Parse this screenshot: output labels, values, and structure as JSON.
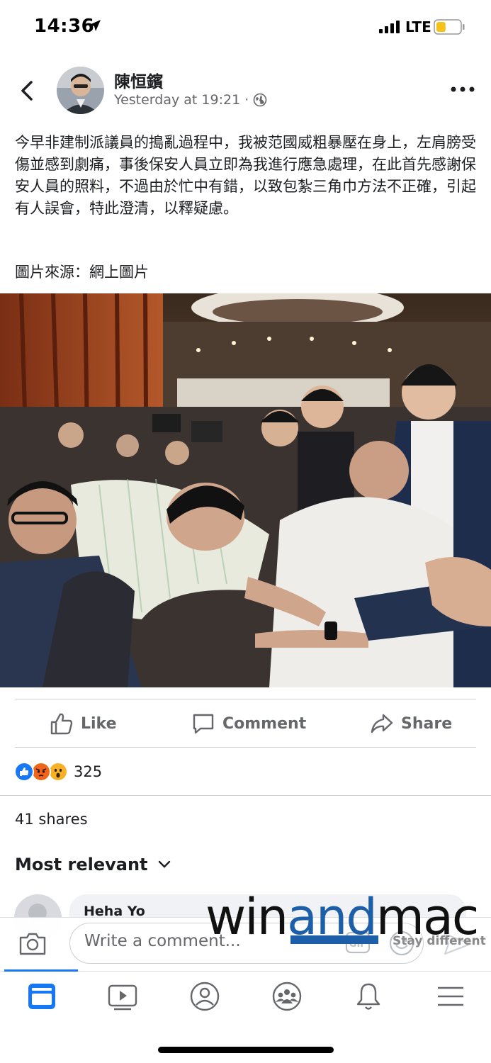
{
  "status_bar": {
    "time": "14:36",
    "network": "LTE",
    "battery_level": 0.4,
    "battery_color": "#f6c21a"
  },
  "post": {
    "author": "陳恒鑌",
    "timestamp": "Yesterday at 19:21",
    "separator": "·",
    "audience_icon": "globe-icon",
    "text": "今早非建制派議員的搗亂過程中，我被范國威粗暴壓在身上，左肩膀受傷並感到劇痛，事後保安人員立即為我進行應急處理，在此首先感謝保安人員的照料，不過由於忙中有錯，以致包紮三角巾方法不正確，引起有人誤會，特此澄清，以釋疑慮。",
    "source": "圖片來源：網上圖片"
  },
  "actions": {
    "like": "Like",
    "comment": "Comment",
    "share": "Share"
  },
  "reactions": {
    "types": [
      "like",
      "angry",
      "wow"
    ],
    "count": "325"
  },
  "shares": "41 shares",
  "sort": {
    "label": "Most relevant"
  },
  "comment_preview": {
    "name": "Heha Yo"
  },
  "composer": {
    "placeholder": "Write a comment..."
  },
  "watermark": {
    "win": "win",
    "and": "and",
    "mac": "mac",
    "tagline": "Stay different"
  },
  "nav": {
    "items": [
      "home-icon",
      "video-icon",
      "profile-icon",
      "groups-icon",
      "notifications-icon",
      "menu-icon"
    ],
    "active": "home-icon",
    "accent": "#1877f2"
  }
}
